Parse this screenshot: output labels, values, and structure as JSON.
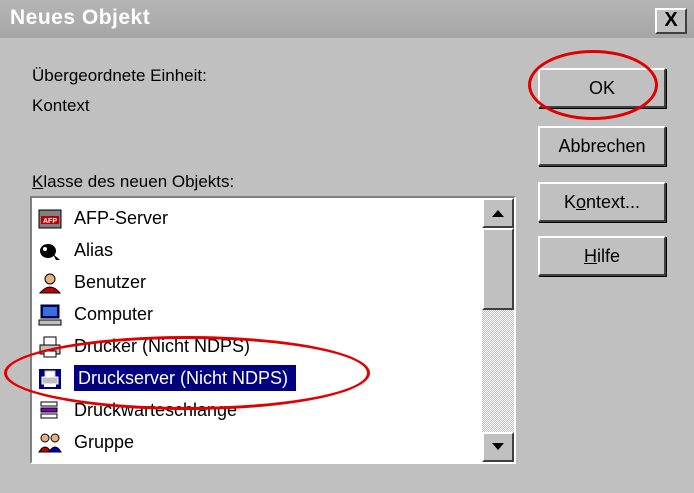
{
  "window": {
    "title": "Neues Objekt",
    "close_glyph": "X"
  },
  "parent": {
    "label": "Übergeordnete Einheit:",
    "value": "Kontext"
  },
  "class_list": {
    "label": "Klasse des neuen Objekts:",
    "items": [
      {
        "label": "AFP-Server",
        "icon": "afp-server-icon"
      },
      {
        "label": "Alias",
        "icon": "alias-icon"
      },
      {
        "label": "Benutzer",
        "icon": "user-icon"
      },
      {
        "label": "Computer",
        "icon": "computer-icon"
      },
      {
        "label": "Drucker (Nicht NDPS)",
        "icon": "printer-icon"
      },
      {
        "label": "Druckserver (Nicht NDPS)",
        "icon": "print-server-icon",
        "selected": true
      },
      {
        "label": "Druckwarteschlange",
        "icon": "print-queue-icon"
      },
      {
        "label": "Gruppe",
        "icon": "group-icon"
      }
    ]
  },
  "buttons": {
    "ok": "OK",
    "cancel": "Abbrechen",
    "context": "Kontext...",
    "help": "Hilfe"
  },
  "annotations": {
    "color": "#e00000"
  },
  "colors": {
    "selection": "#000080",
    "dialog_bg": "#c0c0c0"
  }
}
